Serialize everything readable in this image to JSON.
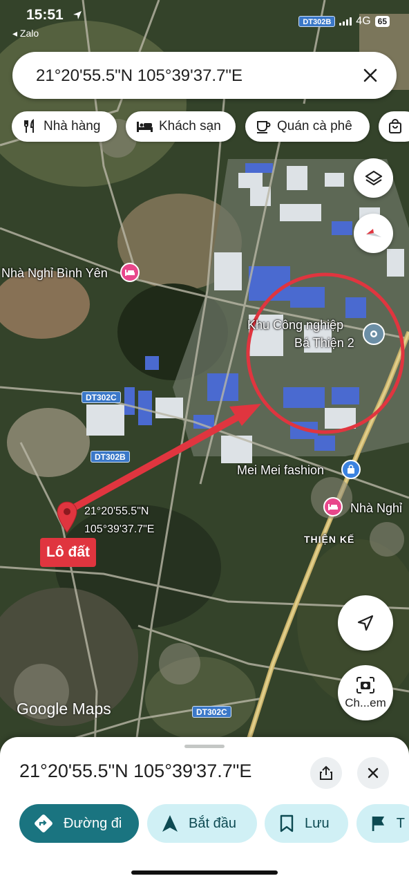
{
  "status": {
    "time": "15:51",
    "back_app": "◂ Zalo",
    "road_badge": "DT302B",
    "network": "4G",
    "battery": "65"
  },
  "search": {
    "query": "21°20'55.5\"N 105°39'37.7\"E"
  },
  "chips": [
    {
      "label": "Nhà hàng",
      "icon": "restaurant-icon"
    },
    {
      "label": "Khách sạn",
      "icon": "hotel-icon"
    },
    {
      "label": "Quán cà phê",
      "icon": "coffee-icon"
    },
    {
      "label": "",
      "icon": "shopping-bag-icon"
    }
  ],
  "map": {
    "pois": {
      "hotel_binh_yen": "Nhà Nghỉ Bình Yên",
      "industrial_park_line1": "Khu Công nghiệp",
      "industrial_park_line2": "Bá Thiện 2",
      "mei_mei": "Mei Mei fashion",
      "nha_nghi_right": "Nhà Nghỉ",
      "thien_ke": "THIỆN KẾ"
    },
    "roads": {
      "dt302c_a": "DT302C",
      "dt302b": "DT302B",
      "dt302c_b": "DT302C"
    },
    "marker": {
      "label": "Lô đất",
      "coord_line1": "21°20'55.5\"N",
      "coord_line2": "105°39'37.7\"E",
      "color": "#e0353f"
    },
    "annotation_color": "#e0353f",
    "logo": "Google Maps",
    "camera_button_label": "Ch...em"
  },
  "sheet": {
    "title": "21°20'55.5\"N 105°39'37.7\"E",
    "actions": [
      {
        "label": "Đường đi",
        "icon": "directions-icon"
      },
      {
        "label": "Bắt đầu",
        "icon": "navigation-icon"
      },
      {
        "label": "Lưu",
        "icon": "bookmark-icon"
      },
      {
        "label": "T",
        "icon": "flag-icon"
      }
    ]
  }
}
